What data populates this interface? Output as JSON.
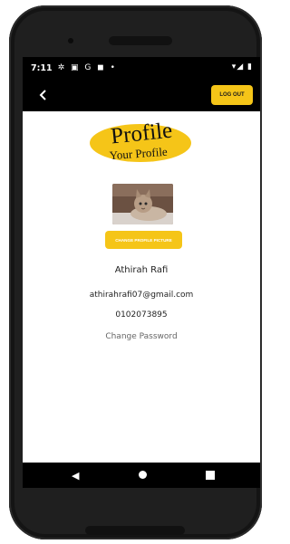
{
  "statusbar": {
    "time": "7:11",
    "icons_left": "✲ ▣ G ◼ •",
    "icons_right": "▾◢ ▮"
  },
  "appbar": {
    "back_icon": "back-arrow-icon",
    "logout_label": "LOG OUT"
  },
  "logo": {
    "title": "Profile",
    "subtitle": "Your Profile",
    "color": "#f5c518"
  },
  "profile": {
    "change_picture_label": "CHANGE PROFILE PICTURE",
    "name": "Athirah Rafi",
    "email": "athirahrafi07@gmail.com",
    "phone": "0102073895",
    "change_password_label": "Change Password"
  },
  "navbar": {
    "back": "◀",
    "home": "home-circle-icon",
    "recents": "recents-square-icon"
  },
  "colors": {
    "accent": "#f5c518",
    "bar": "#000000"
  }
}
